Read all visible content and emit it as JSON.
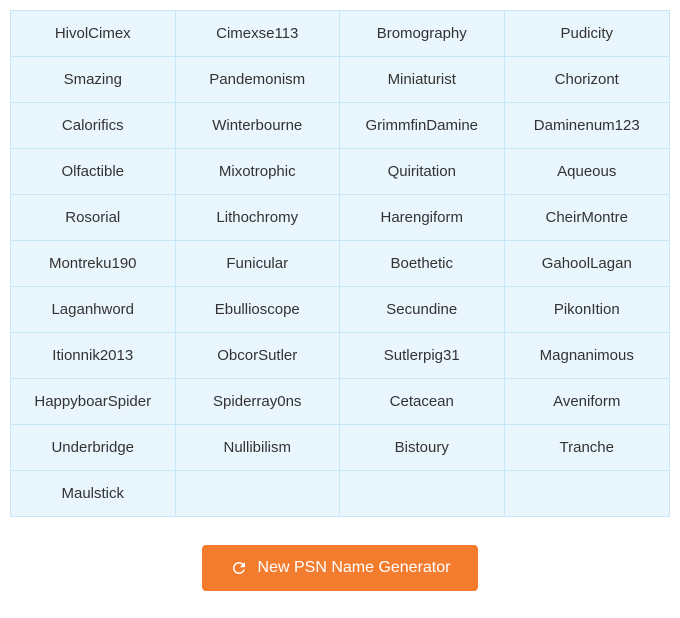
{
  "grid": {
    "rows": [
      [
        "HivolCimex",
        "Cimexse113",
        "Bromography",
        "Pudicity"
      ],
      [
        "Smazing",
        "Pandemonism",
        "Miniaturist",
        "Chorizont"
      ],
      [
        "Calorifics",
        "Winterbourne",
        "GrimmfinDamine",
        "Daminenum123"
      ],
      [
        "Olfactible",
        "Mixotrophic",
        "Quiritation",
        "Aqueous"
      ],
      [
        "Rosorial",
        "Lithochromy",
        "Harengiform",
        "CheirMontre"
      ],
      [
        "Montreku190",
        "Funicular",
        "Boethetic",
        "GahoolLagan"
      ],
      [
        "Laganhword",
        "Ebullioscope",
        "Secundine",
        "PikonItion"
      ],
      [
        "Itionnik2013",
        "ObcorSutler",
        "Sutlerpig31",
        "Magnanimous"
      ],
      [
        "HappyboarSpider",
        "Spiderray0ns",
        "Cetacean",
        "Aveniform"
      ],
      [
        "Underbridge",
        "Nullibilism",
        "Bistoury",
        "Tranche"
      ],
      [
        "Maulstick",
        "",
        "",
        ""
      ]
    ]
  },
  "button": {
    "label": "New PSN Name Generator"
  }
}
